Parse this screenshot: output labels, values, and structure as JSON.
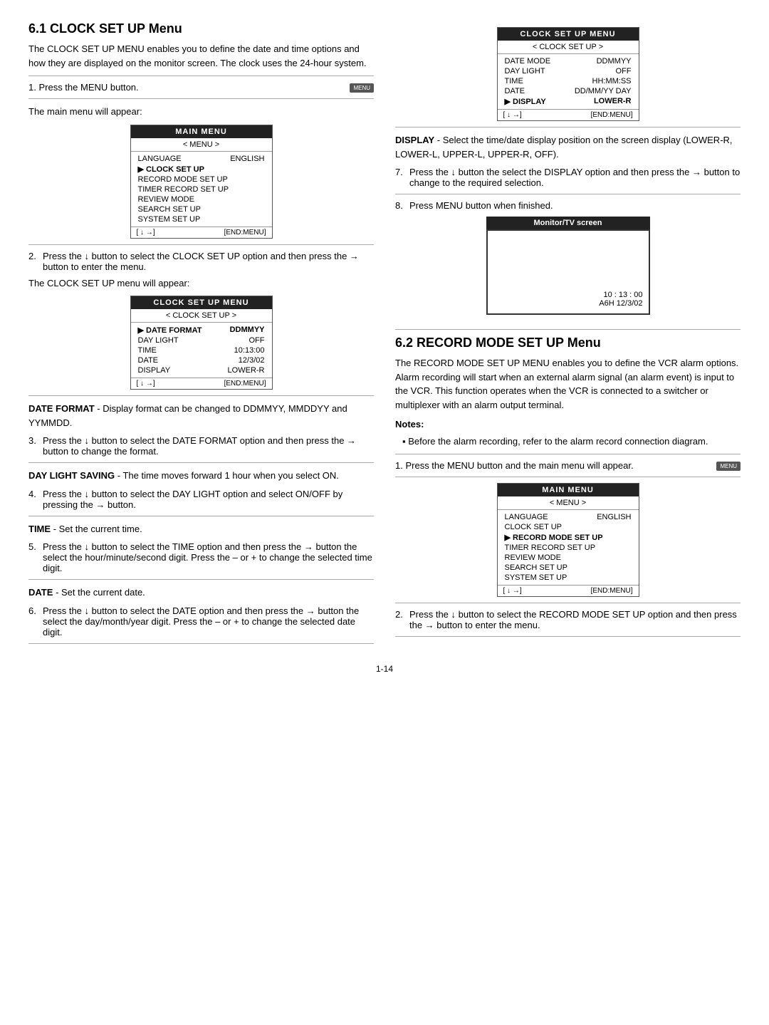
{
  "section61": {
    "title": "6.1  CLOCK SET UP Menu",
    "intro": "The CLOCK SET UP MENU enables you to define the date and time options and how they are displayed on the monitor screen. The clock uses the 24-hour system.",
    "step1": "Press the MENU button.",
    "step1_btn": "MENU",
    "main_menu_will_appear": "The main menu will appear:",
    "main_menu": {
      "title": "MAIN MENU",
      "header": "< MENU >",
      "rows": [
        {
          "label": "LANGUAGE",
          "value": "ENGLISH",
          "selected": false
        },
        {
          "label": "CLOCK SET UP",
          "value": "",
          "selected": true,
          "arrow": true
        },
        {
          "label": "RECORD MODE SET UP",
          "value": "",
          "selected": false
        },
        {
          "label": "TIMER RECORD SET UP",
          "value": "",
          "selected": false
        },
        {
          "label": "REVIEW MODE",
          "value": "",
          "selected": false
        },
        {
          "label": "SEARCH SET UP",
          "value": "",
          "selected": false
        },
        {
          "label": "SYSTEM SET UP",
          "value": "",
          "selected": false
        }
      ],
      "footer_left": "[ ↓  →]",
      "footer_right": "[END:MENU]"
    },
    "step2": "Press the ↓ button to select the CLOCK SET UP option and then press the → button to enter the menu.",
    "clock_menu_will_appear": "The CLOCK SET UP menu will appear:",
    "clock_set_up_menu1": {
      "title": "CLOCK SET UP MENU",
      "header": "< CLOCK SET UP >",
      "rows": [
        {
          "label": "DATE FORMAT",
          "value": "DDMMYY",
          "selected": true,
          "arrow": true
        },
        {
          "label": "DAY LIGHT",
          "value": "OFF",
          "selected": false
        },
        {
          "label": "TIME",
          "value": "10:13:00",
          "selected": false
        },
        {
          "label": "DATE",
          "value": "12/3/02",
          "selected": false
        },
        {
          "label": "DISPLAY",
          "value": "LOWER-R",
          "selected": false
        }
      ],
      "footer_left": "[ ↓  →]",
      "footer_right": "[END:MENU]"
    },
    "date_format_label": "DATE FORMAT",
    "date_format_desc": "- Display format can be changed to DDMMYY, MMDDYY and YYMMDD.",
    "step3": "Press the ↓ button to select the DATE FORMAT option and then press the → button to change the format.",
    "day_light_label": "DAY LIGHT SAVING",
    "day_light_desc": "- The time moves forward 1 hour when you select ON.",
    "step4": "Press the ↓ button to select the DAY LIGHT option and select ON/OFF by pressing the → button.",
    "time_label": "TIME",
    "time_desc": "- Set the current time.",
    "step5": "Press the ↓ button to select the TIME option and then press the → button the select the hour/minute/second digit. Press the – or + to change the selected time digit.",
    "date_label": "DATE",
    "date_desc": "- Set the current date.",
    "step6": "Press the ↓ button to select the DATE option and then press the → button the select the day/month/year digit. Press the – or + to change the selected date digit."
  },
  "section61_right": {
    "clock_set_up_menu2": {
      "title": "CLOCK SET UP MENU",
      "header": "< CLOCK SET UP >",
      "rows": [
        {
          "label": "DATE MODE",
          "value": "DDMMYY",
          "selected": false
        },
        {
          "label": "DAY LIGHT",
          "value": "OFF",
          "selected": false
        },
        {
          "label": "TIME",
          "value": "HH:MM:SS",
          "selected": false
        },
        {
          "label": "DATE",
          "value": "DD/MM/YY DAY",
          "selected": false
        },
        {
          "label": "DISPLAY",
          "value": "LOWER-R",
          "selected": true,
          "arrow": true
        }
      ],
      "footer_left": "[ ↓  →]",
      "footer_right": "[END:MENU]"
    },
    "display_label": "DISPLAY",
    "display_desc": "- Select the time/date display position on the screen display (LOWER-R, LOWER-L, UPPER-L, UPPER-R, OFF).",
    "step7": "Press the ↓ button the select the DISPLAY option and then press the → button to change to the required selection.",
    "step8": "Press MENU button when finished.",
    "monitor": {
      "title": "Monitor/TV screen",
      "time": "10 : 13 : 00",
      "date": "A6H 12/3/02"
    }
  },
  "section62": {
    "title": "6.2  RECORD MODE SET UP Menu",
    "intro": "The RECORD MODE SET UP MENU enables you to define the VCR alarm options. Alarm recording will start when an external alarm signal (an alarm event) is input to the VCR. This function operates when the VCR is connected to a switcher or multiplexer with an alarm output terminal.",
    "notes_label": "Notes:",
    "notes": [
      "Before the alarm recording, refer to the alarm record connection diagram."
    ],
    "step1": "Press the MENU button and the main menu will appear.",
    "step1_btn": "MENU",
    "main_menu": {
      "title": "MAIN MENU",
      "header": "< MENU >",
      "rows": [
        {
          "label": "LANGUAGE",
          "value": "ENGLISH",
          "selected": false
        },
        {
          "label": "CLOCK SET UP",
          "value": "",
          "selected": false
        },
        {
          "label": "RECORD MODE SET UP",
          "value": "",
          "selected": true,
          "arrow": true
        },
        {
          "label": "TIMER RECORD SET UP",
          "value": "",
          "selected": false
        },
        {
          "label": "REVIEW MODE",
          "value": "",
          "selected": false
        },
        {
          "label": "SEARCH SET UP",
          "value": "",
          "selected": false
        },
        {
          "label": "SYSTEM SET UP",
          "value": "",
          "selected": false
        }
      ],
      "footer_left": "[ ↓  →]",
      "footer_right": "[END:MENU]"
    },
    "step2": "Press the ↓ button to select the RECORD MODE SET UP option and then press the → button to enter the menu."
  },
  "page_number": "1-14"
}
